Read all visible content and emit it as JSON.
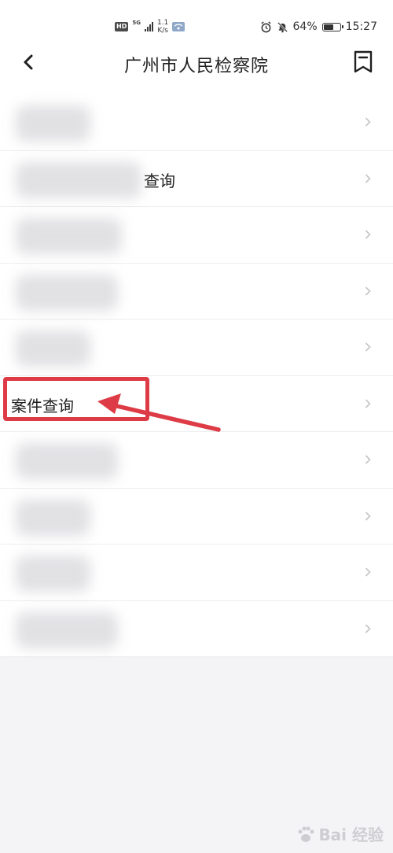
{
  "status_bar": {
    "hd_badge": "HD",
    "network": "5G",
    "speed_value": "1.1",
    "speed_unit": "K/s",
    "battery_percent": "64%",
    "battery_level": 0.64,
    "time": "15:27"
  },
  "nav": {
    "title": "广州市人民检察院",
    "back_icon": "chevron-left-icon",
    "bookmark_icon": "bookmark-icon"
  },
  "list": {
    "items": [
      {
        "label": ""
      },
      {
        "label": "查询"
      },
      {
        "label": ""
      },
      {
        "label": ""
      },
      {
        "label": ""
      },
      {
        "label": "案件查询"
      },
      {
        "label": ""
      },
      {
        "label": ""
      },
      {
        "label": ""
      },
      {
        "label": ""
      }
    ]
  },
  "annotation": {
    "color": "#dd3b45"
  },
  "watermark": {
    "text": "Bai 经验"
  }
}
